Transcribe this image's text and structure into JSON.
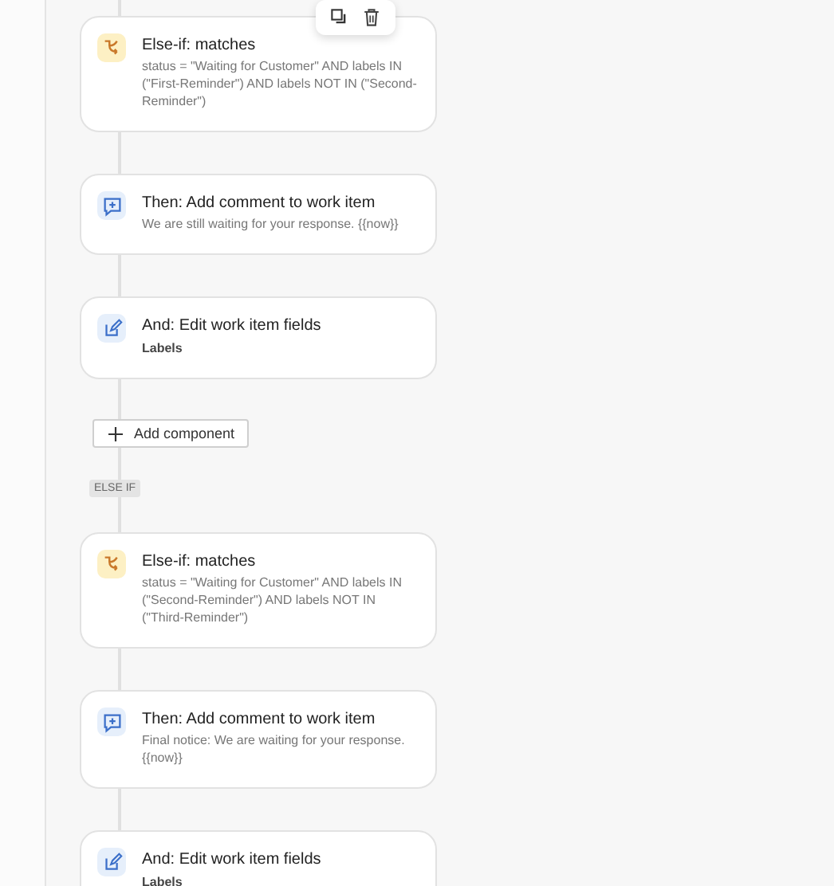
{
  "card_toolbar": {
    "buttons": [
      {
        "kind": "copy"
      },
      {
        "kind": "delete"
      }
    ]
  },
  "items": [
    {
      "kind": "condition",
      "title": "Else-if: matches",
      "detail": "status = \"Waiting for Customer\" AND labels IN (\"First-Reminder\") AND labels NOT IN (\"Second-Reminder\")"
    },
    {
      "kind": "comment",
      "title": "Then: Add comment to work item",
      "detail": "We are still waiting for your response. {{now}}"
    },
    {
      "kind": "edit",
      "title": "And: Edit work item fields",
      "detail": "Labels"
    },
    {
      "kind": "add_button",
      "label": "Add component"
    },
    {
      "kind": "branch_label",
      "label": "ELSE IF"
    },
    {
      "kind": "condition",
      "title": "Else-if: matches",
      "detail": "status = \"Waiting for Customer\" AND labels IN (\"Second-Reminder\") AND labels NOT IN (\"Third-Reminder\")"
    },
    {
      "kind": "comment",
      "title": "Then: Add comment to work item",
      "detail": "Final notice: We are waiting for your response. {{now}}"
    },
    {
      "kind": "edit",
      "title": "And: Edit work item fields",
      "detail": "Labels"
    }
  ]
}
